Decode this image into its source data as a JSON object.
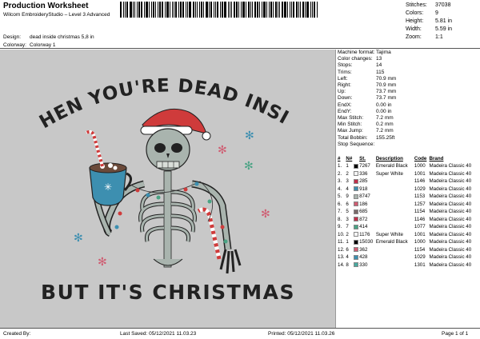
{
  "header": {
    "title": "Production Worksheet",
    "software": "Wilcom EmbroideryStudio – Level 3 Advanced"
  },
  "stats": [
    {
      "label": "Stitches:",
      "value": "37038"
    },
    {
      "label": "Colors:",
      "value": "9"
    },
    {
      "label": "Height:",
      "value": "5.81 in"
    },
    {
      "label": "Width:",
      "value": "5.59 in"
    },
    {
      "label": "Zoom:",
      "value": "1:1"
    }
  ],
  "meta": [
    {
      "label": "Design:",
      "value": "dead inside christmas 5,8 in"
    },
    {
      "label": "Colorway:",
      "value": "Colorway 1"
    }
  ],
  "design_text": {
    "top": "WHEN YOU'RE DEAD INSIDE",
    "bottom": "BUT IT'S CHRISTMAS"
  },
  "machine": [
    {
      "label": "Machine format:",
      "value": "Tajima"
    },
    {
      "label": "Color changes:",
      "value": "13"
    },
    {
      "label": "Stops:",
      "value": "14"
    },
    {
      "label": "Trims:",
      "value": "115"
    },
    {
      "label": "Left:",
      "value": "70.9 mm"
    },
    {
      "label": "Right:",
      "value": "70.9 mm"
    },
    {
      "label": "Up:",
      "value": "73.7 mm"
    },
    {
      "label": "Down:",
      "value": "73.7 mm"
    },
    {
      "label": "EndX:",
      "value": "0.00 in"
    },
    {
      "label": "EndY:",
      "value": "0.00 in"
    },
    {
      "label": "Max Stitch:",
      "value": "7.2 mm"
    },
    {
      "label": "Min Stitch:",
      "value": "0.2 mm"
    },
    {
      "label": "Max Jump:",
      "value": "7.2 mm"
    },
    {
      "label": "Total Bobbin:",
      "value": "155.25ft"
    },
    {
      "label": "Stop Sequence:",
      "value": ""
    }
  ],
  "stop_table": {
    "headers": [
      "#",
      "N#",
      "",
      "St.",
      "Description",
      "Code",
      "Brand"
    ],
    "rows": [
      {
        "num": "1.",
        "n": "1",
        "color": "#000000",
        "st": "7267",
        "desc": "Emerald Black",
        "code": "1000",
        "brand": "Madeira Classic 40"
      },
      {
        "num": "2.",
        "n": "2",
        "color": "#f4f4f4",
        "st": "336",
        "desc": "Super White",
        "code": "1001",
        "brand": "Madeira Classic 40"
      },
      {
        "num": "3.",
        "n": "3",
        "color": "#c0304a",
        "st": "285",
        "desc": "",
        "code": "1146",
        "brand": "Madeira Classic 40"
      },
      {
        "num": "4.",
        "n": "4",
        "color": "#3d8fb0",
        "st": "918",
        "desc": "",
        "code": "1029",
        "brand": "Madeira Classic 40"
      },
      {
        "num": "5.",
        "n": "9",
        "color": "#a9b4ae",
        "st": "8747",
        "desc": "",
        "code": "1153",
        "brand": "Madeira Classic 40"
      },
      {
        "num": "6.",
        "n": "6",
        "color": "#cf5d72",
        "st": "186",
        "desc": "",
        "code": "1257",
        "brand": "Madeira Classic 40"
      },
      {
        "num": "7.",
        "n": "5",
        "color": "#7a6a6a",
        "st": "685",
        "desc": "",
        "code": "1154",
        "brand": "Madeira Classic 40"
      },
      {
        "num": "8.",
        "n": "3",
        "color": "#c0304a",
        "st": "872",
        "desc": "",
        "code": "1146",
        "brand": "Madeira Classic 40"
      },
      {
        "num": "9.",
        "n": "7",
        "color": "#4aa384",
        "st": "414",
        "desc": "",
        "code": "1077",
        "brand": "Madeira Classic 40"
      },
      {
        "num": "10.",
        "n": "2",
        "color": "#f4f4f4",
        "st": "1176",
        "desc": "Super White",
        "code": "1001",
        "brand": "Madeira Classic 40"
      },
      {
        "num": "11.",
        "n": "1",
        "color": "#000000",
        "st": "15030",
        "desc": "Emerald Black",
        "code": "1000",
        "brand": "Madeira Classic 40"
      },
      {
        "num": "12.",
        "n": "6",
        "color": "#cf5d72",
        "st": "362",
        "desc": "",
        "code": "1154",
        "brand": "Madeira Classic 40"
      },
      {
        "num": "13.",
        "n": "4",
        "color": "#3d8fb0",
        "st": "428",
        "desc": "",
        "code": "1029",
        "brand": "Madeira Classic 40"
      },
      {
        "num": "14.",
        "n": "8",
        "color": "#49a9a0",
        "st": "330",
        "desc": "",
        "code": "1301",
        "brand": "Madeira Classic 40"
      }
    ]
  },
  "footer": {
    "created_by": "Created By:",
    "last_saved": "Last Saved: 05/12/2021 11.03.23",
    "printed": "Printed: 05/12/2021 11.03.26",
    "page": "Page 1 of 1"
  }
}
